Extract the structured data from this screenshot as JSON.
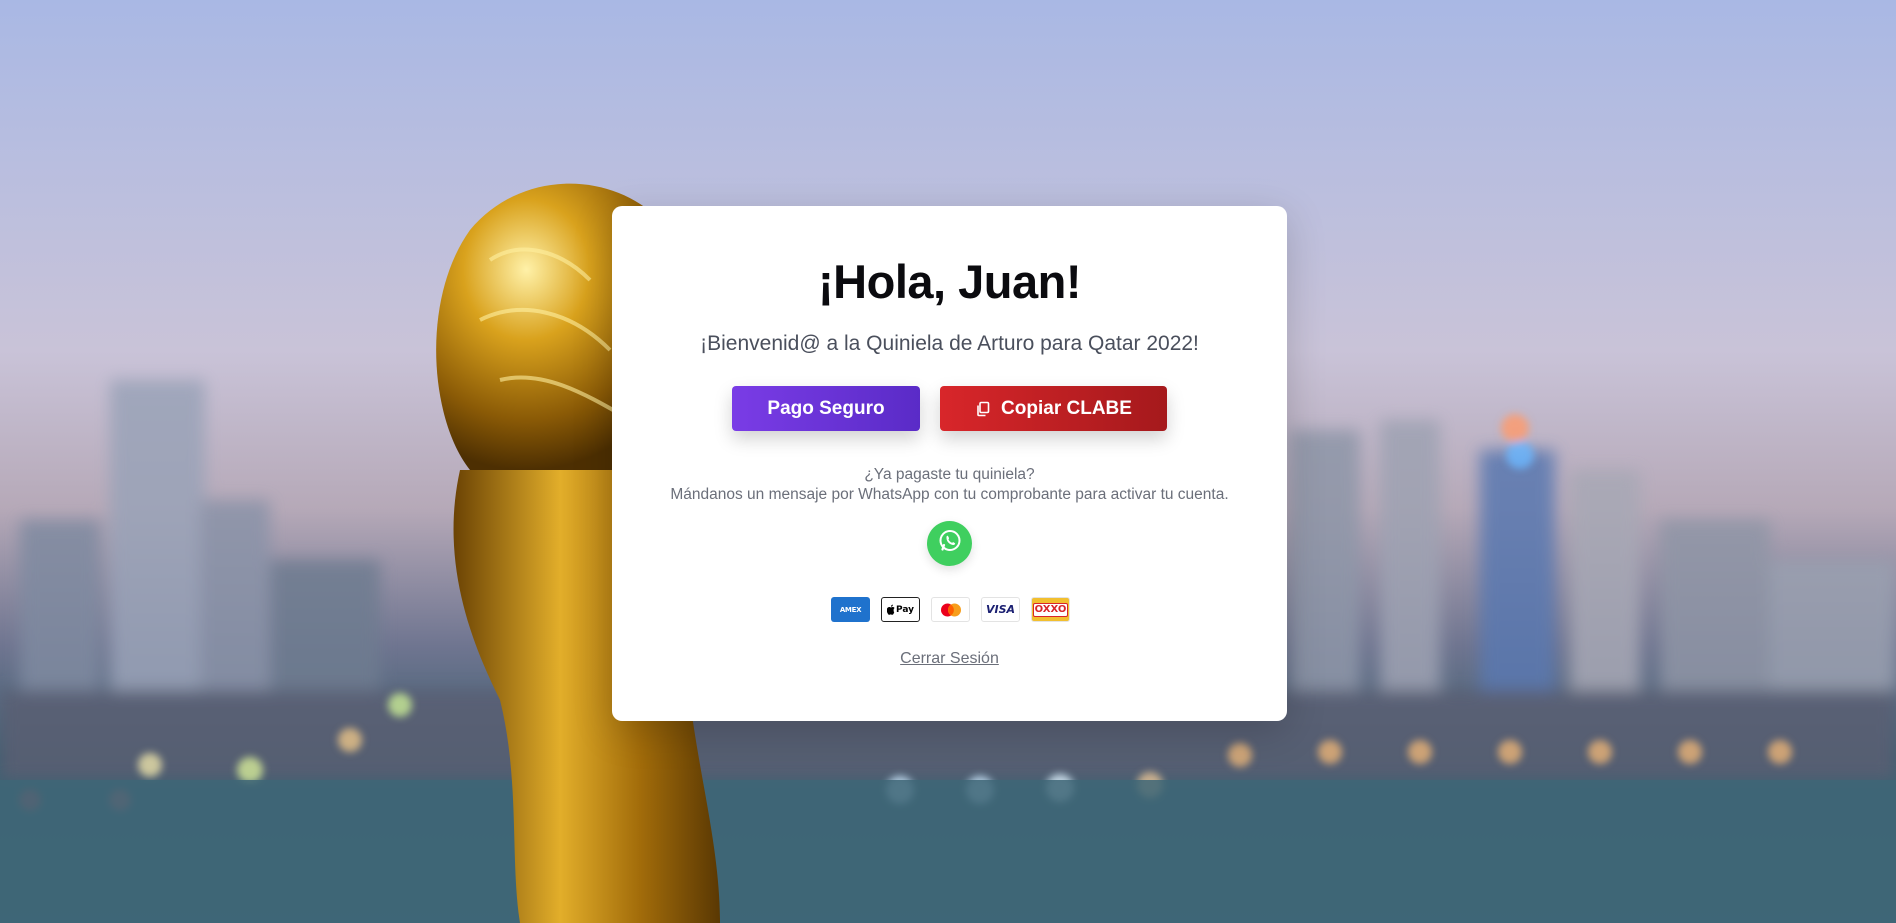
{
  "card": {
    "greeting": "¡Hola, Juan!",
    "welcome": "¡Bienvenid@ a la Quiniela de Arturo para Qatar 2022!",
    "pay_button": "Pago Seguro",
    "clabe_button": "Copiar CLABE",
    "paid_question": "¿Ya pagaste tu quiniela?",
    "paid_message": "Mándanos un mensaje por WhatsApp con tu comprobante para activar tu cuenta.",
    "payment_methods": [
      "AMEX",
      "Pay",
      "",
      "VISA",
      "OXXO"
    ],
    "logout": "Cerrar Sesión"
  },
  "colors": {
    "pay_button": "#6a34d8",
    "clabe_button": "#c32024",
    "whatsapp": "#3fcf5f"
  },
  "icons": {
    "copy": "copy-icon",
    "whatsapp": "whatsapp-icon",
    "background": "world-cup-trophy-over-doha-skyline"
  }
}
